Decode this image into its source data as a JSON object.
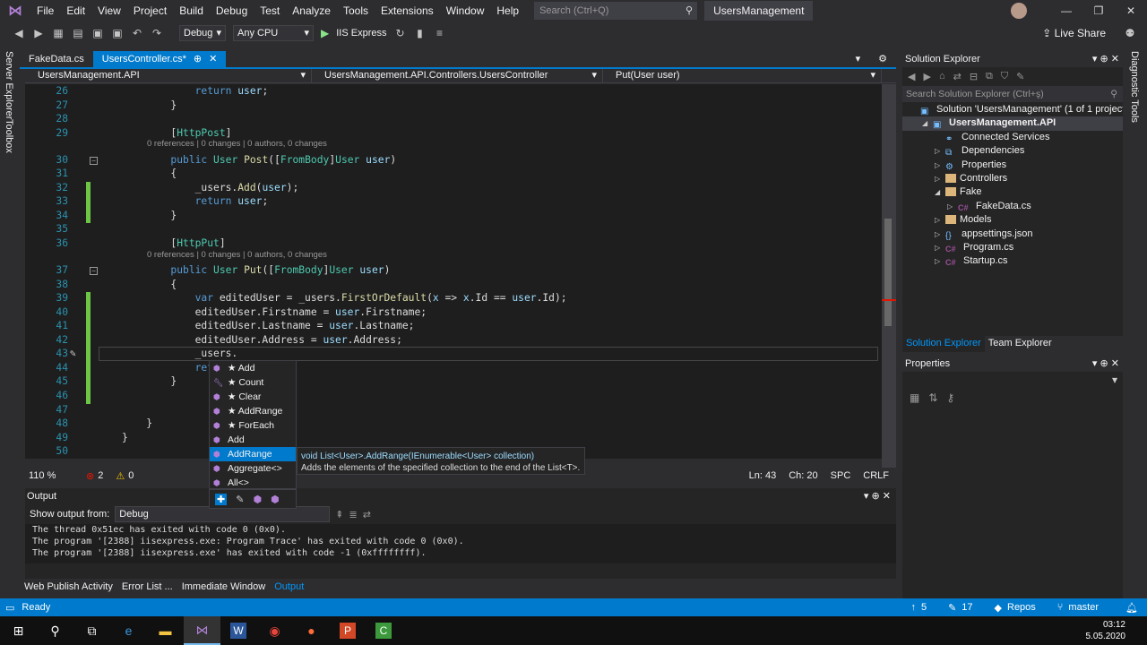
{
  "menu": [
    "File",
    "Edit",
    "View",
    "Project",
    "Build",
    "Debug",
    "Test",
    "Analyze",
    "Tools",
    "Extensions",
    "Window",
    "Help"
  ],
  "search": {
    "placeholder": "Search (Ctrl+Q)"
  },
  "solution_name": "UsersManagement",
  "toolbar": {
    "config": "Debug",
    "platform": "Any CPU",
    "run_target": "IIS Express",
    "live_share": "Live Share"
  },
  "left_tabs": [
    "Server Explorer",
    "Toolbox"
  ],
  "right_tabs": [
    "Diagnostic Tools"
  ],
  "tabs": [
    {
      "label": "FakeData.cs"
    },
    {
      "label": "UsersController.cs*",
      "pin": "⊕",
      "close": "✕"
    }
  ],
  "navbar": {
    "project": "UsersManagement.API",
    "class": "UsersManagement.API.Controllers.UsersController",
    "member": "Put(User user)"
  },
  "editor": {
    "lines": [
      {
        "n": "26",
        "text": "            return user;"
      },
      {
        "n": "27",
        "text": "        }"
      },
      {
        "n": "28",
        "text": ""
      },
      {
        "n": "29",
        "text": "        [HttpPost]"
      },
      {
        "n": "30",
        "text": "        public User Post([FromBody]User user)"
      },
      {
        "n": "31",
        "text": "        {"
      },
      {
        "n": "32",
        "text": "            _users.Add(user);"
      },
      {
        "n": "33",
        "text": "            return user;"
      },
      {
        "n": "34",
        "text": "        }"
      },
      {
        "n": "35",
        "text": ""
      },
      {
        "n": "36",
        "text": "        [HttpPut]"
      },
      {
        "n": "37",
        "text": "        public User Put([FromBody]User user)"
      },
      {
        "n": "38",
        "text": "        {"
      },
      {
        "n": "39",
        "text": "            var editedUser = _users.FirstOrDefault(x => x.Id == user.Id);"
      },
      {
        "n": "40",
        "text": "            editedUser.Firstname = user.Firstname;"
      },
      {
        "n": "41",
        "text": "            editedUser.Lastname = user.Lastname;"
      },
      {
        "n": "42",
        "text": "            editedUser.Address = user.Address;"
      },
      {
        "n": "43",
        "text": "            _users."
      },
      {
        "n": "44",
        "text": "            return"
      },
      {
        "n": "45",
        "text": "        }"
      },
      {
        "n": "46",
        "text": ""
      },
      {
        "n": "47",
        "text": ""
      },
      {
        "n": "48",
        "text": "    }"
      },
      {
        "n": "49",
        "text": "}"
      },
      {
        "n": "50",
        "text": ""
      }
    ],
    "codelens": "0 references | 0 changes | 0 authors, 0 changes"
  },
  "editor_status": {
    "zoom": "110 %",
    "errors": "2",
    "warnings": "0",
    "line": "Ln: 43",
    "col": "Ch: 20",
    "spc": "SPC",
    "crlf": "CRLF"
  },
  "intellisense": {
    "items": [
      "★ Add",
      "★ Count",
      "★ Clear",
      "★ AddRange",
      "★ ForEach",
      "Add",
      "AddRange",
      "Aggregate<>",
      "All<>"
    ],
    "selected": "AddRange",
    "tooltip_sig": "void List<User>.AddRange(IEnumerable<User> collection)",
    "tooltip_desc": "Adds the elements of the specified collection to the end of the List<T>."
  },
  "output": {
    "title": "Output",
    "show_from_label": "Show output from:",
    "source": "Debug",
    "lines": [
      "The thread 0x51ec has exited with code 0 (0x0).",
      "The program '[2388] iisexpress.exe: Program Trace' has exited with code 0 (0x0).",
      "The program '[2388] iisexpress.exe' has exited with code -1 (0xffffffff)."
    ]
  },
  "bottom_tabs": [
    "Web Publish Activity",
    "Error List ...",
    "Immediate Window",
    "Output"
  ],
  "solution_explorer": {
    "title": "Solution Explorer",
    "search": "Search Solution Explorer (Ctrl+ş)",
    "items": [
      {
        "label": "Solution 'UsersManagement' (1 of 1 project)",
        "indent": 0,
        "icon": "solution"
      },
      {
        "label": "UsersManagement.API",
        "indent": 1,
        "icon": "project",
        "selected": true
      },
      {
        "label": "Connected Services",
        "indent": 2,
        "icon": "service"
      },
      {
        "label": "Dependencies",
        "indent": 2,
        "icon": "deps"
      },
      {
        "label": "Properties",
        "indent": 2,
        "icon": "props"
      },
      {
        "label": "Controllers",
        "indent": 2,
        "icon": "folder"
      },
      {
        "label": "Fake",
        "indent": 2,
        "icon": "folder"
      },
      {
        "label": "FakeData.cs",
        "indent": 3,
        "icon": "csharp"
      },
      {
        "label": "Models",
        "indent": 2,
        "icon": "folder"
      },
      {
        "label": "appsettings.json",
        "indent": 2,
        "icon": "json"
      },
      {
        "label": "Program.cs",
        "indent": 2,
        "icon": "csharp"
      },
      {
        "label": "Startup.cs",
        "indent": 2,
        "icon": "csharp"
      }
    ]
  },
  "panel_tabs": [
    "Solution Explorer",
    "Team Explorer"
  ],
  "properties": {
    "title": "Properties"
  },
  "statusbar": {
    "ready": "Ready",
    "up": "5",
    "edits": "17",
    "repos": "Repos",
    "branch": "master"
  },
  "clock": {
    "time": "03:12",
    "date": "5.05.2020"
  }
}
